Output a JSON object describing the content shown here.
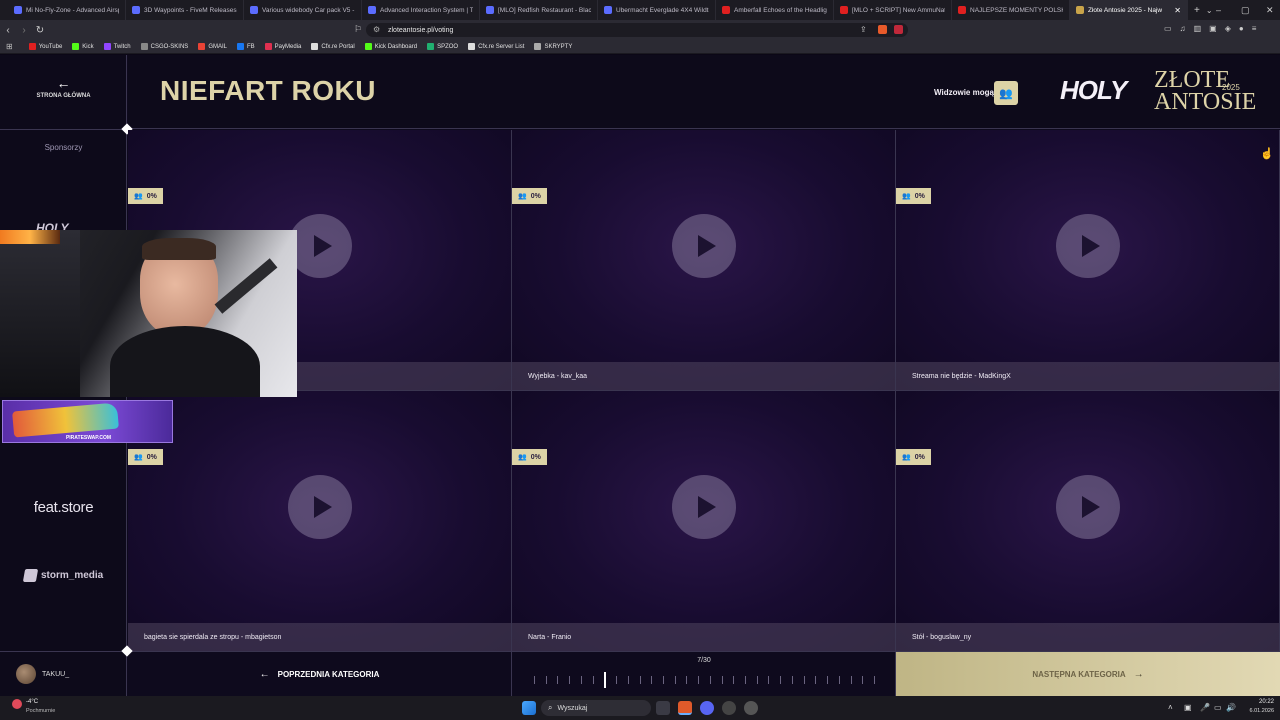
{
  "browser": {
    "tabs": [
      {
        "label": "Mi No-Fly-Zone - Advanced Airsp",
        "color": "#5b6cff"
      },
      {
        "label": "3D Waypoints - FiveM Releases - C",
        "color": "#5b6cff"
      },
      {
        "label": "Various widebody Car pack V5 - Fi",
        "color": "#5b6cff"
      },
      {
        "label": "Advanced Interaction System | Tar",
        "color": "#5b6cff"
      },
      {
        "label": "[MLO] Redfish Restaurant - BlackM",
        "color": "#5b6cff"
      },
      {
        "label": "Ubermacht Everglade 4X4 Wildtra",
        "color": "#5b6cff"
      },
      {
        "label": "Amberfall Echoes of the Headlight",
        "color": "#e02020"
      },
      {
        "label": "[MLO + SCRIPT] New AmmuNatio",
        "color": "#e02020"
      },
      {
        "label": "NAJLEPSZE MOMENTY POLSKIEGO",
        "color": "#e02020"
      },
      {
        "label": "Złote Antosie 2025 - Najw",
        "color": "#c9a44a",
        "active": true
      }
    ],
    "url": "zloteantosie.pl/voting",
    "bookmarks": [
      {
        "label": "YouTube",
        "color": "#e02020"
      },
      {
        "label": "Kick",
        "color": "#53fc18"
      },
      {
        "label": "Twitch",
        "color": "#9146ff"
      },
      {
        "label": "CSGO-SKINS",
        "color": "#888888"
      },
      {
        "label": "GMAIL",
        "color": "#ea4335"
      },
      {
        "label": "FB",
        "color": "#1877f2"
      },
      {
        "label": "PayMedia",
        "color": "#e03050"
      },
      {
        "label": "Cfx.re Portal",
        "color": "#dddddd"
      },
      {
        "label": "Kick Dashboard",
        "color": "#53fc18"
      },
      {
        "label": "SPZOO",
        "color": "#20b070"
      },
      {
        "label": "Cfx.re Server List",
        "color": "#dddddd"
      },
      {
        "label": "SKRYPTY",
        "color": "#aaaaaa"
      }
    ]
  },
  "sidebar": {
    "home_label": "STRONA GŁÓWNA",
    "sponsors_label": "Sponsorzy",
    "sponsor_feat": "feat.store",
    "sponsor_storm": "storm_media",
    "promo_label": "PIRATESWAP.COM",
    "user_name": "TAKUU_"
  },
  "header": {
    "category_title": "NIEFART ROKU",
    "viewers_label": "Widzowie mogą",
    "logo_holy": "HOLY",
    "logo_line1": "ZŁOTE",
    "logo_line2": "ANTOSIE",
    "logo_year": "2025"
  },
  "nominees": [
    {
      "percent": "0%",
      "caption": ""
    },
    {
      "percent": "0%",
      "caption": "Wyjebka - kav_kaa"
    },
    {
      "percent": "0%",
      "caption": "Streama nie będzie - MadKingX"
    },
    {
      "percent": "0%",
      "caption": "bagieta sie spierdala ze stropu - mbagietson"
    },
    {
      "percent": "0%",
      "caption": "Narta - Franio"
    },
    {
      "percent": "0%",
      "caption": "Stół - boguslaw_ny"
    }
  ],
  "footer": {
    "prev_label": "POPRZEDNIA KATEGORIA",
    "next_label": "NASTĘPNA KATEGORIA",
    "progress_text": "7/30",
    "progress_current": 7,
    "progress_total": 30
  },
  "taskbar": {
    "weather_temp": "-4°C",
    "weather_desc": "Pochmurnie",
    "search_placeholder": "Wyszukaj",
    "time": "20:22",
    "date": "6.01.2026"
  },
  "colors": {
    "accent_gold": "#dcd3a6",
    "bg_purple": "#180c30"
  }
}
